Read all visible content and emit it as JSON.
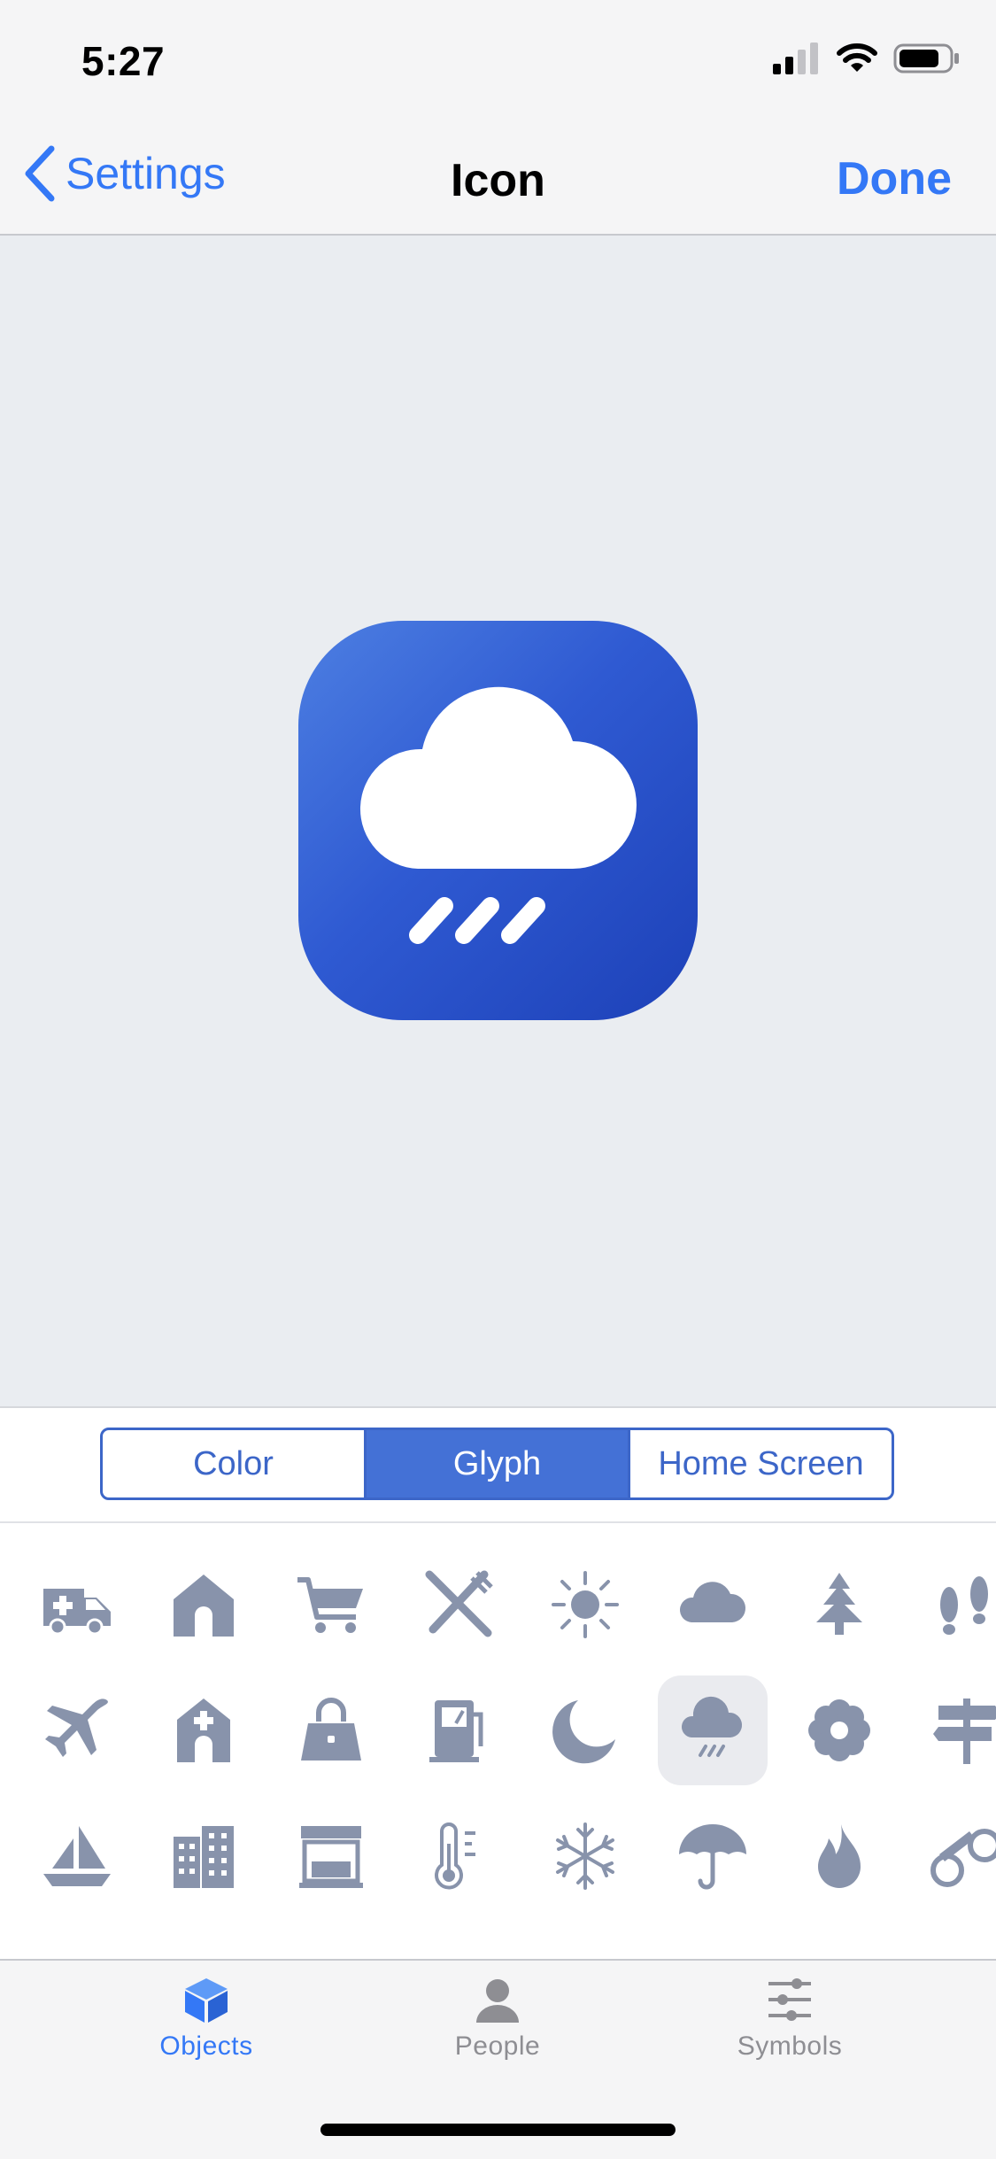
{
  "status": {
    "time": "5:27"
  },
  "nav": {
    "back_label": "Settings",
    "title": "Icon",
    "done_label": "Done"
  },
  "preview": {
    "glyph": "cloud-rain-icon",
    "gradient": [
      "#4d7fe2",
      "#1d41b8"
    ]
  },
  "segments": [
    {
      "label": "Color",
      "active": false
    },
    {
      "label": "Glyph",
      "active": true
    },
    {
      "label": "Home Screen",
      "active": false
    }
  ],
  "glyphs": {
    "color": "#8893ab",
    "selected_index": 13,
    "rows": [
      [
        "ambulance-icon",
        "house-icon",
        "cart-icon",
        "fork-knife-icon",
        "sun-icon",
        "cloud-icon",
        "tree-icon",
        "footprints-icon"
      ],
      [
        "airplane-icon",
        "hospital-icon",
        "handbag-icon",
        "fuel-pump-icon",
        "moon-icon",
        "cloud-rain-icon",
        "flower-icon",
        "signpost-icon"
      ],
      [
        "sailboat-icon",
        "building-icon",
        "storefront-icon",
        "thermometer-icon",
        "snowflake-icon",
        "umbrella-icon",
        "flame-icon",
        "binoculars-icon"
      ]
    ]
  },
  "tabs": [
    {
      "label": "Objects",
      "icon": "cube-icon",
      "active": true
    },
    {
      "label": "People",
      "icon": "person-icon",
      "active": false
    },
    {
      "label": "Symbols",
      "icon": "sliders-icon",
      "active": false
    }
  ],
  "colors": {
    "accent": "#3478f6",
    "segment": "#3c66c8",
    "glyph": "#8893ab"
  }
}
